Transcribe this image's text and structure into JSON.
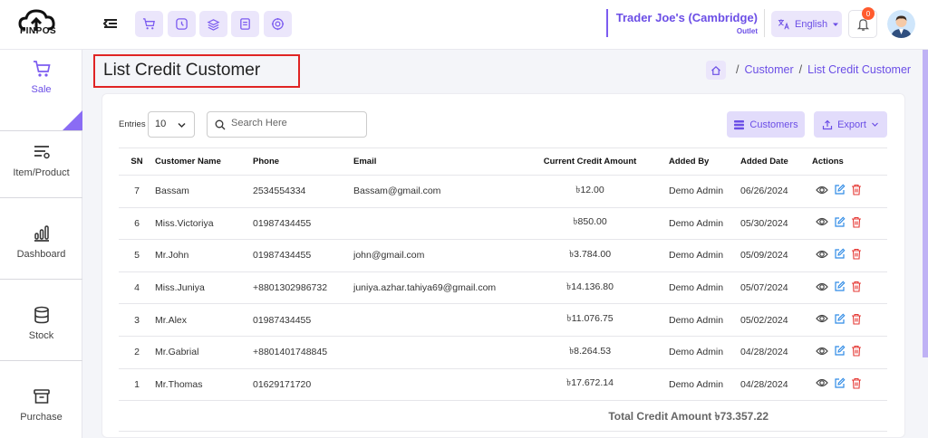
{
  "brand": {
    "logo_text": "FINPOS"
  },
  "header": {
    "quick_actions": [
      "cart-icon",
      "clock-icon",
      "stack-icon",
      "receipt-icon",
      "target-icon"
    ],
    "store_name": "Trader Joe's (Cambridge)",
    "store_type": "Outlet",
    "language": "English",
    "notification_count": "0"
  },
  "sidebar": {
    "items": [
      {
        "label": "Sale",
        "icon": "cart-icon",
        "active": true
      },
      {
        "label": "Item/Product",
        "icon": "list-filter-icon"
      },
      {
        "label": "Dashboard",
        "icon": "bar-chart-icon"
      },
      {
        "label": "Stock",
        "icon": "database-icon"
      },
      {
        "label": "Purchase",
        "icon": "archive-icon"
      }
    ]
  },
  "page": {
    "title": "List Credit Customer",
    "breadcrumb": [
      "Customer",
      "List Credit Customer"
    ]
  },
  "controls": {
    "entries_label": "Entries",
    "entries_value": "10",
    "search_placeholder": "Search Here",
    "customers_button": "Customers",
    "export_button": "Export"
  },
  "table": {
    "headers": [
      "SN",
      "Customer Name",
      "Phone",
      "Email",
      "Current Credit Amount",
      "Added By",
      "Added Date",
      "Actions"
    ],
    "rows": [
      [
        "7",
        "Bassam",
        "2534554334",
        "Bassam@gmail.com",
        "৳12.00",
        "Demo Admin",
        "06/26/2024"
      ],
      [
        "6",
        "Miss.Victoriya",
        "01987434455",
        "",
        "৳850.00",
        "Demo Admin",
        "05/30/2024"
      ],
      [
        "5",
        "Mr.John",
        "01987434455",
        "john@gmail.com",
        "৳3.784.00",
        "Demo Admin",
        "05/09/2024"
      ],
      [
        "4",
        "Miss.Juniya",
        "+8801302986732",
        "juniya.azhar.tahiya69@gmail.com",
        "৳14.136.80",
        "Demo Admin",
        "05/07/2024"
      ],
      [
        "3",
        "Mr.Alex",
        "01987434455",
        "",
        "৳11.076.75",
        "Demo Admin",
        "05/02/2024"
      ],
      [
        "2",
        "Mr.Gabrial",
        "+8801401748845",
        "",
        "৳8.264.53",
        "Demo Admin",
        "04/28/2024"
      ],
      [
        "1",
        "Mr.Thomas",
        "01629171720",
        "",
        "৳17.672.14",
        "Demo Admin",
        "04/28/2024"
      ]
    ],
    "total_text": "Total Credit Amount ৳73.357.22"
  },
  "colors": {
    "accent": "#6b4ee6",
    "accent_light": "#ebe6fb",
    "delete": "#e53935",
    "highlight_box": "#e02424"
  }
}
